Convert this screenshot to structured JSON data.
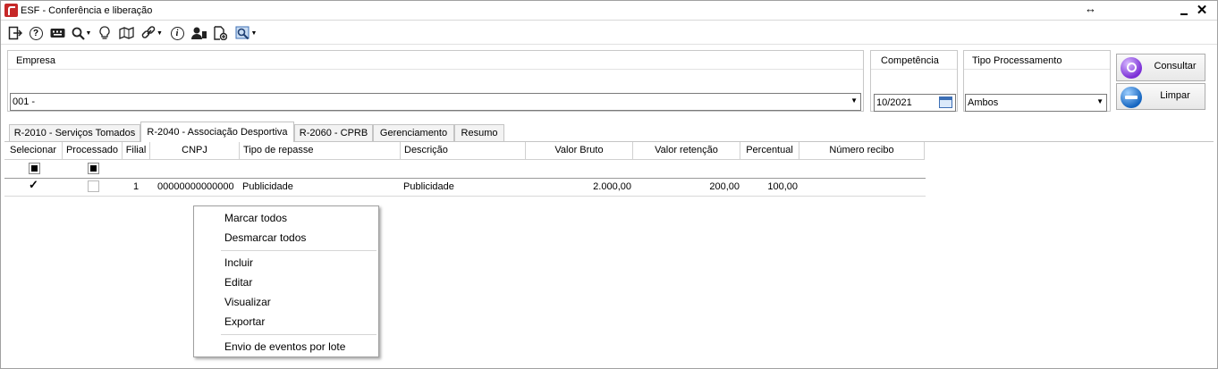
{
  "window": {
    "title": "ESF - Conferência e liberação",
    "resize_glyph": "↔",
    "minimize_icon": "minimize-icon",
    "close_glyph": "✕"
  },
  "toolbar": {
    "icons": [
      "exit-icon",
      "help-icon",
      "keyboard-icon",
      "search-icon",
      "lightbulb-icon",
      "map-icon",
      "link-icon",
      "info-icon",
      "user-icon",
      "new-document-icon",
      "tools-icon"
    ]
  },
  "form": {
    "empresa": {
      "label": "Empresa",
      "value": "001 -"
    },
    "competencia": {
      "label": "Competência",
      "value": "10/2021"
    },
    "tipo_processamento": {
      "label": "Tipo Processamento",
      "value": "Ambos"
    },
    "buttons": {
      "consultar": "Consultar",
      "limpar": "Limpar"
    }
  },
  "tabs": [
    {
      "label": "R-2010 - Serviços Tomados",
      "active": false
    },
    {
      "label": "R-2040 - Associação Desportiva",
      "active": true
    },
    {
      "label": "R-2060 - CPRB",
      "active": false
    },
    {
      "label": "Gerenciamento",
      "active": false
    },
    {
      "label": "Resumo",
      "active": false
    }
  ],
  "grid": {
    "columns": [
      "Selecionar",
      "Processado",
      "Filial",
      "CNPJ",
      "Tipo de repasse",
      "Descrição",
      "Valor Bruto",
      "Valor retenção",
      "Percentual",
      "Número recibo"
    ],
    "rows": [
      {
        "selecionar": true,
        "processado": false,
        "filial": "1",
        "cnpj": "00000000000000",
        "tipo_repasse": "Publicidade",
        "descricao": "Publicidade",
        "valor_bruto": "2.000,00",
        "valor_retencao": "200,00",
        "percentual": "100,00",
        "numero_recibo": ""
      }
    ]
  },
  "context_menu": {
    "items": [
      "Marcar todos",
      "Desmarcar todos",
      "Incluir",
      "Editar",
      "Visualizar",
      "Exportar",
      "Envio de eventos por lote"
    ]
  },
  "colors": {
    "app_icon": "#c62828",
    "consultar_orb": "#7b2fd6",
    "limpar_orb": "#1565c0"
  }
}
